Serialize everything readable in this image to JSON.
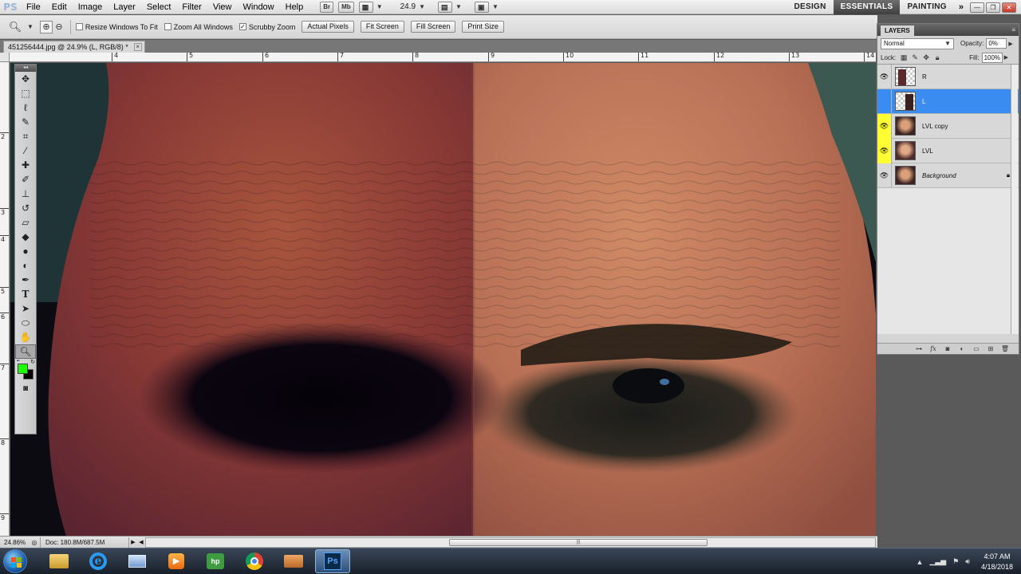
{
  "app": {
    "logo": "PS",
    "menu": [
      "File",
      "Edit",
      "Image",
      "Layer",
      "Select",
      "Filter",
      "View",
      "Window",
      "Help"
    ],
    "appbar": {
      "bridge": "Br",
      "minibridge": "Mb",
      "zoom": "24.9"
    },
    "workspaces": [
      "DESIGN",
      "ESSENTIALS",
      "PAINTING"
    ],
    "active_workspace": "ESSENTIALS",
    "more": "»"
  },
  "options": {
    "resize_windows": "Resize Windows To Fit",
    "zoom_all": "Zoom All Windows",
    "scrubby_zoom": "Scrubby Zoom",
    "scrubby_checked": true,
    "buttons": [
      "Actual Pixels",
      "Fit Screen",
      "Fill Screen",
      "Print Size"
    ]
  },
  "document": {
    "tab_title": "451256444.jpg @ 24.9% (L, RGB/8) *",
    "close": "×"
  },
  "rulers": {
    "top": [
      "4",
      "5",
      "6",
      "7",
      "8",
      "9",
      "10",
      "11",
      "12",
      "13",
      "14"
    ],
    "left": [
      "2",
      "3",
      "4",
      "5",
      "6",
      "7",
      "8",
      "9"
    ]
  },
  "tools": [
    "move-tool",
    "marquee-tool",
    "lasso-tool",
    "quick-select-tool",
    "crop-tool",
    "eyedropper-tool",
    "healing-brush-tool",
    "brush-tool",
    "clone-stamp-tool",
    "history-brush-tool",
    "eraser-tool",
    "paint-bucket-tool",
    "blur-tool",
    "dodge-tool",
    "pen-tool",
    "type-tool",
    "path-select-tool",
    "ellipse-tool",
    "hand-tool",
    "zoom-tool"
  ],
  "colors": {
    "foreground": "#1cff00",
    "background": "#000000",
    "selection": "#3b8cf0"
  },
  "status": {
    "zoom": "24.86%",
    "doc": "Doc: 180.8M/687.5M"
  },
  "layers_panel": {
    "title": "LAYERS",
    "blend_mode": "Normal",
    "opacity_label": "Opacity:",
    "opacity": "0%",
    "lock_label": "Lock:",
    "fill_label": "Fill:",
    "fill": "100%",
    "layers": [
      {
        "name": "R",
        "visible": true,
        "selected": false,
        "eye_color": "",
        "thumb": "mask"
      },
      {
        "name": "L",
        "visible": false,
        "selected": true,
        "eye_color": "#e88a8a",
        "thumb": "mask"
      },
      {
        "name": "LVL copy",
        "visible": true,
        "selected": false,
        "eye_color": "#ffff33",
        "thumb": "face"
      },
      {
        "name": "LVL",
        "visible": true,
        "selected": false,
        "eye_color": "#ffff33",
        "thumb": "face"
      },
      {
        "name": "Background",
        "visible": true,
        "selected": false,
        "eye_color": "",
        "thumb": "face",
        "locked": true
      }
    ]
  },
  "taskbar": {
    "apps": [
      "explorer",
      "internet-explorer",
      "computer",
      "media-player",
      "hp",
      "chrome",
      "file-manager",
      "photoshop"
    ],
    "active": "photoshop",
    "time": "4:07 AM",
    "date": "4/18/2018"
  }
}
